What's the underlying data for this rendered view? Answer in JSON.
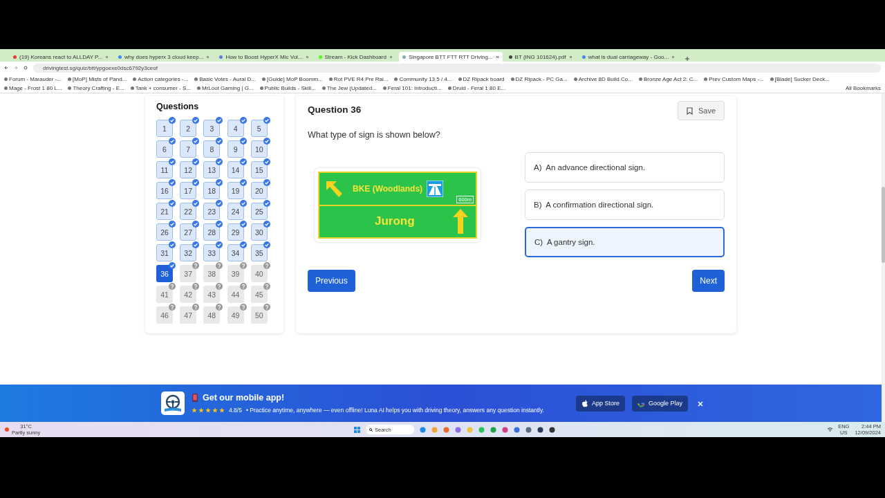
{
  "browser": {
    "tabs": [
      {
        "title": "(19) Koreans react to ALLDAY P...",
        "selected": false
      },
      {
        "title": "why does hyperx 3 cloud keep...",
        "selected": false
      },
      {
        "title": "How to Boost HyperX Mic Vol...",
        "selected": false
      },
      {
        "title": "Stream - Kick Dashboard",
        "selected": false
      },
      {
        "title": "Singapore BTT FTT RTT Driving...",
        "selected": true
      },
      {
        "title": "BT (ING 101624).pdf",
        "selected": false
      },
      {
        "title": "what is dual carriageway - Goo...",
        "selected": false
      }
    ],
    "url": "drivingtest.sg/quiz/btt/ypgoexe0dsc6792y3ceof",
    "bookmarks": [
      "Forum - Marauder -...",
      "[MoP] Mists of Pand...",
      "Action categories -...",
      "Basic Votes - Aural D...",
      "[Guide] MoP Boomm...",
      "Rot PVE R4 Pre Rai...",
      "Community 13.5 / 4...",
      "DZ Ripack board",
      "DZ Ripack - PC Ga...",
      "Archive 8D Build Co...",
      "Bronze Age Act 2: C...",
      "Prev Custom Maps -...",
      "[Blade] Sucker Deck...",
      "Mage - Frost 1 80 L...",
      "Theory Crafting - E...",
      "Tank + consumer - S...",
      "MrLoot Gaming | G...",
      "Public Builds - Skill...",
      "The Jew (Updated...",
      "Feral 101: Introducti...",
      "Druid - Feral 1 80 E..."
    ],
    "all_bookmarks": "All Bookmarks"
  },
  "sidebar": {
    "title": "Questions",
    "questions": [
      {
        "number": "1",
        "answered": true,
        "selected": false
      },
      {
        "number": "2",
        "answered": true,
        "selected": false
      },
      {
        "number": "3",
        "answered": true,
        "selected": false
      },
      {
        "number": "4",
        "answered": true,
        "selected": false
      },
      {
        "number": "5",
        "answered": true,
        "selected": false
      },
      {
        "number": "6",
        "answered": true,
        "selected": false
      },
      {
        "number": "7",
        "answered": true,
        "selected": false
      },
      {
        "number": "8",
        "answered": true,
        "selected": false
      },
      {
        "number": "9",
        "answered": true,
        "selected": false
      },
      {
        "number": "10",
        "answered": true,
        "selected": false
      },
      {
        "number": "11",
        "answered": true,
        "selected": false
      },
      {
        "number": "12",
        "answered": true,
        "selected": false
      },
      {
        "number": "13",
        "answered": true,
        "selected": false
      },
      {
        "number": "14",
        "answered": true,
        "selected": false
      },
      {
        "number": "15",
        "answered": true,
        "selected": false
      },
      {
        "number": "16",
        "answered": true,
        "selected": false
      },
      {
        "number": "17",
        "answered": true,
        "selected": false
      },
      {
        "number": "18",
        "answered": true,
        "selected": false
      },
      {
        "number": "19",
        "answered": true,
        "selected": false
      },
      {
        "number": "20",
        "answered": true,
        "selected": false
      },
      {
        "number": "21",
        "answered": true,
        "selected": false
      },
      {
        "number": "22",
        "answered": true,
        "selected": false
      },
      {
        "number": "23",
        "answered": true,
        "selected": false
      },
      {
        "number": "24",
        "answered": true,
        "selected": false
      },
      {
        "number": "25",
        "answered": true,
        "selected": false
      },
      {
        "number": "26",
        "answered": true,
        "selected": false
      },
      {
        "number": "27",
        "answered": true,
        "selected": false
      },
      {
        "number": "28",
        "answered": true,
        "selected": false
      },
      {
        "number": "29",
        "answered": true,
        "selected": false
      },
      {
        "number": "30",
        "answered": true,
        "selected": false
      },
      {
        "number": "31",
        "answered": true,
        "selected": false
      },
      {
        "number": "32",
        "answered": true,
        "selected": false
      },
      {
        "number": "33",
        "answered": true,
        "selected": false
      },
      {
        "number": "34",
        "answered": true,
        "selected": false
      },
      {
        "number": "35",
        "answered": true,
        "selected": false
      },
      {
        "number": "36",
        "answered": true,
        "selected": true
      },
      {
        "number": "37",
        "answered": false,
        "selected": false
      },
      {
        "number": "38",
        "answered": false,
        "selected": false
      },
      {
        "number": "39",
        "answered": false,
        "selected": false
      },
      {
        "number": "40",
        "answered": false,
        "selected": false
      },
      {
        "number": "41",
        "answered": false,
        "selected": false
      },
      {
        "number": "42",
        "answered": false,
        "selected": false
      },
      {
        "number": "43",
        "answered": false,
        "selected": false
      },
      {
        "number": "44",
        "answered": false,
        "selected": false
      },
      {
        "number": "45",
        "answered": false,
        "selected": false
      },
      {
        "number": "46",
        "answered": false,
        "selected": false
      },
      {
        "number": "47",
        "answered": false,
        "selected": false
      },
      {
        "number": "48",
        "answered": false,
        "selected": false
      },
      {
        "number": "49",
        "answered": false,
        "selected": false
      },
      {
        "number": "50",
        "answered": false,
        "selected": false
      }
    ]
  },
  "question": {
    "title": "Question 36",
    "save": "Save",
    "text": "What type of sign is shown below?",
    "sign": {
      "top": "BKE (Woodlands)",
      "distance": "600m",
      "bottom": "Jurong"
    },
    "options": [
      {
        "letter": "A)",
        "text": "An advance directional sign.",
        "selected": false
      },
      {
        "letter": "B)",
        "text": "A confirmation directional sign.",
        "selected": false
      },
      {
        "letter": "C)",
        "text": "A gantry sign.",
        "selected": true
      }
    ],
    "previous": "Previous",
    "next": "Next"
  },
  "banner": {
    "title": "Get our mobile app!",
    "stars": 5,
    "rating": "4.8/5",
    "text": "• Practice anytime, anywhere — even offline! Luna AI helps you with driving theory, answers any question instantly.",
    "buttons": [
      {
        "kind": "apple",
        "label": "App Store"
      },
      {
        "kind": "google",
        "label": "Google Play"
      }
    ]
  },
  "taskbar": {
    "temperature": "31°C",
    "weather": "Partly sunny",
    "search": "Search",
    "language": "ENG",
    "layout": "US",
    "time": "2:44 PM",
    "date": "12/09/2024"
  }
}
